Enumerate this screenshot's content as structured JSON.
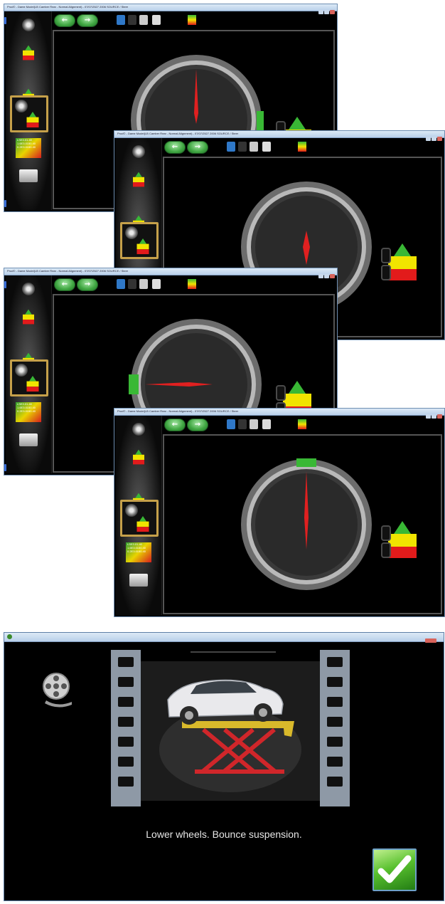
{
  "windows": [
    {
      "title": "Prod© - Dame Model(LB Camber Rear - Normal Alignment) - 07/07/2527 2006 SOURCE / Steer",
      "needle": "up"
    },
    {
      "title": "Prod© - Dame Model(LB Camber Rear - Normal Alignment) - 07/07/2527 2006 SOURCE / Steer",
      "needle": "down"
    },
    {
      "title": "Prod© - Dame Model(LB Camber Rear - Normal Alignment) - 07/07/2527 2006 SOURCE / Steer",
      "needle": "left"
    },
    {
      "title": "Prod© - Dame Model(LB Camber Rear - Normal Alignment) - 07/07/2527 2006 SOURCE / Steer",
      "needle": "up"
    }
  ],
  "sidebar": {
    "items": [
      {
        "icon": "vehicle-select-icon"
      },
      {
        "icon": "car-spec-icon"
      },
      {
        "icon": "wheel-runout-icon"
      },
      {
        "icon": "wheel-caster-icon"
      },
      {
        "icon": "spec-table-icon",
        "lines": [
          "LSE3.01.40",
          "1.6E3.0150.40",
          "0.2E3.0150.40"
        ]
      },
      {
        "icon": "printer-icon"
      }
    ]
  },
  "toolbar": {
    "back_icon": "arrow-left-icon",
    "forward_icon": "arrow-right-icon",
    "tools": [
      "help-icon",
      "camera-icon",
      "home-icon",
      "print-icon",
      "car-status-icon"
    ]
  },
  "colors": {
    "accent_green": "#39b835",
    "car_yellow": "#f1e400",
    "car_red": "#e21b1b",
    "needle_red": "#e02020",
    "selection_gold": "#c5a04a"
  },
  "video": {
    "caption": "Lower wheels. Bounce suspension.",
    "confirm_icon": "checkmark-icon",
    "reel_icon": "film-reel-icon"
  }
}
